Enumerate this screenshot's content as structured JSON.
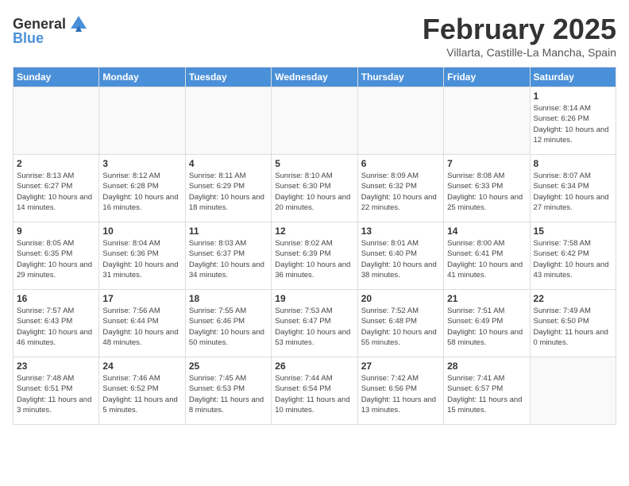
{
  "header": {
    "logo_general": "General",
    "logo_blue": "Blue",
    "title": "February 2025",
    "location": "Villarta, Castille-La Mancha, Spain"
  },
  "weekdays": [
    "Sunday",
    "Monday",
    "Tuesday",
    "Wednesday",
    "Thursday",
    "Friday",
    "Saturday"
  ],
  "weeks": [
    [
      {
        "day": "",
        "info": ""
      },
      {
        "day": "",
        "info": ""
      },
      {
        "day": "",
        "info": ""
      },
      {
        "day": "",
        "info": ""
      },
      {
        "day": "",
        "info": ""
      },
      {
        "day": "",
        "info": ""
      },
      {
        "day": "1",
        "info": "Sunrise: 8:14 AM\nSunset: 6:26 PM\nDaylight: 10 hours and 12 minutes."
      }
    ],
    [
      {
        "day": "2",
        "info": "Sunrise: 8:13 AM\nSunset: 6:27 PM\nDaylight: 10 hours and 14 minutes."
      },
      {
        "day": "3",
        "info": "Sunrise: 8:12 AM\nSunset: 6:28 PM\nDaylight: 10 hours and 16 minutes."
      },
      {
        "day": "4",
        "info": "Sunrise: 8:11 AM\nSunset: 6:29 PM\nDaylight: 10 hours and 18 minutes."
      },
      {
        "day": "5",
        "info": "Sunrise: 8:10 AM\nSunset: 6:30 PM\nDaylight: 10 hours and 20 minutes."
      },
      {
        "day": "6",
        "info": "Sunrise: 8:09 AM\nSunset: 6:32 PM\nDaylight: 10 hours and 22 minutes."
      },
      {
        "day": "7",
        "info": "Sunrise: 8:08 AM\nSunset: 6:33 PM\nDaylight: 10 hours and 25 minutes."
      },
      {
        "day": "8",
        "info": "Sunrise: 8:07 AM\nSunset: 6:34 PM\nDaylight: 10 hours and 27 minutes."
      }
    ],
    [
      {
        "day": "9",
        "info": "Sunrise: 8:05 AM\nSunset: 6:35 PM\nDaylight: 10 hours and 29 minutes."
      },
      {
        "day": "10",
        "info": "Sunrise: 8:04 AM\nSunset: 6:36 PM\nDaylight: 10 hours and 31 minutes."
      },
      {
        "day": "11",
        "info": "Sunrise: 8:03 AM\nSunset: 6:37 PM\nDaylight: 10 hours and 34 minutes."
      },
      {
        "day": "12",
        "info": "Sunrise: 8:02 AM\nSunset: 6:39 PM\nDaylight: 10 hours and 36 minutes."
      },
      {
        "day": "13",
        "info": "Sunrise: 8:01 AM\nSunset: 6:40 PM\nDaylight: 10 hours and 38 minutes."
      },
      {
        "day": "14",
        "info": "Sunrise: 8:00 AM\nSunset: 6:41 PM\nDaylight: 10 hours and 41 minutes."
      },
      {
        "day": "15",
        "info": "Sunrise: 7:58 AM\nSunset: 6:42 PM\nDaylight: 10 hours and 43 minutes."
      }
    ],
    [
      {
        "day": "16",
        "info": "Sunrise: 7:57 AM\nSunset: 6:43 PM\nDaylight: 10 hours and 46 minutes."
      },
      {
        "day": "17",
        "info": "Sunrise: 7:56 AM\nSunset: 6:44 PM\nDaylight: 10 hours and 48 minutes."
      },
      {
        "day": "18",
        "info": "Sunrise: 7:55 AM\nSunset: 6:46 PM\nDaylight: 10 hours and 50 minutes."
      },
      {
        "day": "19",
        "info": "Sunrise: 7:53 AM\nSunset: 6:47 PM\nDaylight: 10 hours and 53 minutes."
      },
      {
        "day": "20",
        "info": "Sunrise: 7:52 AM\nSunset: 6:48 PM\nDaylight: 10 hours and 55 minutes."
      },
      {
        "day": "21",
        "info": "Sunrise: 7:51 AM\nSunset: 6:49 PM\nDaylight: 10 hours and 58 minutes."
      },
      {
        "day": "22",
        "info": "Sunrise: 7:49 AM\nSunset: 6:50 PM\nDaylight: 11 hours and 0 minutes."
      }
    ],
    [
      {
        "day": "23",
        "info": "Sunrise: 7:48 AM\nSunset: 6:51 PM\nDaylight: 11 hours and 3 minutes."
      },
      {
        "day": "24",
        "info": "Sunrise: 7:46 AM\nSunset: 6:52 PM\nDaylight: 11 hours and 5 minutes."
      },
      {
        "day": "25",
        "info": "Sunrise: 7:45 AM\nSunset: 6:53 PM\nDaylight: 11 hours and 8 minutes."
      },
      {
        "day": "26",
        "info": "Sunrise: 7:44 AM\nSunset: 6:54 PM\nDaylight: 11 hours and 10 minutes."
      },
      {
        "day": "27",
        "info": "Sunrise: 7:42 AM\nSunset: 6:56 PM\nDaylight: 11 hours and 13 minutes."
      },
      {
        "day": "28",
        "info": "Sunrise: 7:41 AM\nSunset: 6:57 PM\nDaylight: 11 hours and 15 minutes."
      },
      {
        "day": "",
        "info": ""
      }
    ]
  ]
}
